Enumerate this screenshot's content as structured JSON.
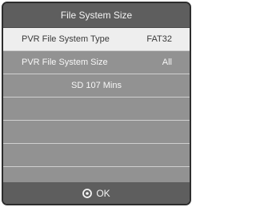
{
  "dialog": {
    "title": "File System Size",
    "rows": [
      {
        "label": "PVR File System Type",
        "value": "FAT32"
      },
      {
        "label": "PVR File System Size",
        "value": "All"
      },
      {
        "text": "SD 107 Mins"
      }
    ],
    "footer": {
      "ok_label": "OK",
      "ok_icon": "ok-circle-icon"
    }
  },
  "colors": {
    "title_bg": "#5e5e5e",
    "row_bg": "#929292",
    "selected_row_bg": "#eeeeee",
    "border": "#2d2d2d"
  }
}
